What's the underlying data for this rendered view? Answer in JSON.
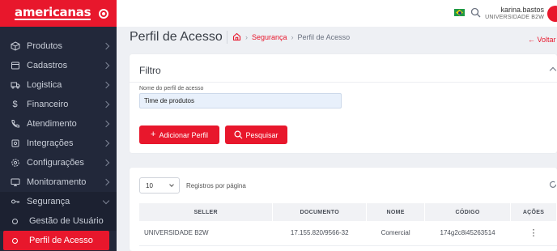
{
  "brand": {
    "name": "americanas"
  },
  "sidebar": {
    "items": [
      {
        "label": "Produtos",
        "icon": "box-icon"
      },
      {
        "label": "Cadastros",
        "icon": "folder-icon"
      },
      {
        "label": "Logistica",
        "icon": "truck-icon"
      },
      {
        "label": "Financeiro",
        "icon": "dollar-icon"
      },
      {
        "label": "Atendimento",
        "icon": "phone-icon"
      },
      {
        "label": "Integrações",
        "icon": "cog-icon"
      },
      {
        "label": "Configurações",
        "icon": "settings-icon"
      },
      {
        "label": "Monitoramento",
        "icon": "monitor-icon"
      },
      {
        "label": "Segurança",
        "icon": "key-icon"
      }
    ],
    "subitems": [
      {
        "label": "Gestão de Usuário"
      },
      {
        "label": "Perfil de Acesso"
      }
    ]
  },
  "topbar": {
    "user_name": "karina.bastos",
    "user_org": "UNIVERSIDADE B2W"
  },
  "header": {
    "title": "Perfil de Acesso",
    "breadcrumb": [
      "Segurança",
      "Perfil de Acesso"
    ],
    "back_label": "Voltar"
  },
  "filter": {
    "title": "Filtro",
    "field_label": "Nome do perfil de acesso",
    "field_value": "Time de produtos",
    "add_button": "Adicionar Perfil",
    "search_button": "Pesquisar"
  },
  "results": {
    "per_page_value": "10",
    "per_page_label": "Registros por página",
    "columns": [
      "SELLER",
      "DOCUMENTO",
      "NOME",
      "CÓDIGO",
      "AÇÕES"
    ],
    "rows": [
      {
        "seller": "UNIVERSIDADE B2W",
        "documento": "17.155.820/9566-32",
        "nome": "Comercial",
        "codigo": "174g2c8i45263514"
      }
    ]
  },
  "colors": {
    "accent": "#e8172c",
    "sidebar": "#22283a"
  }
}
